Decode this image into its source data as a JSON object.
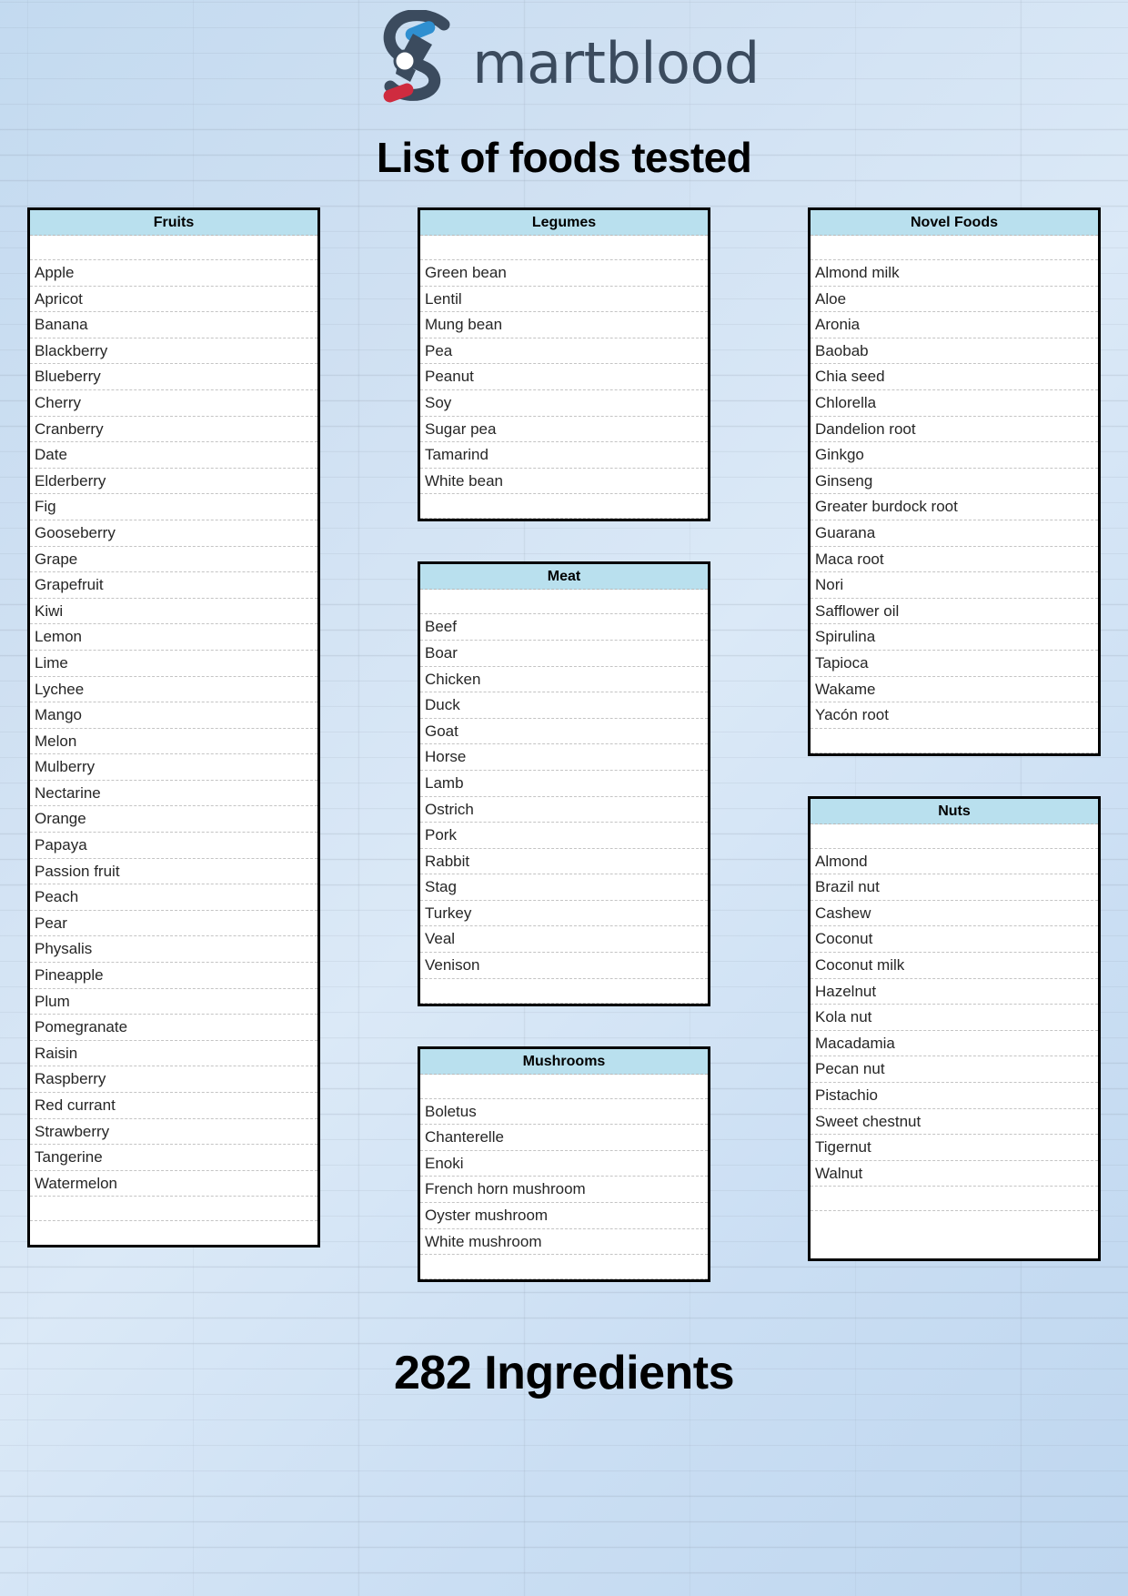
{
  "brand": {
    "name": "Smartblood",
    "text_after_mark": "martblood",
    "logo_icon": "microscope-s-logo",
    "colors": {
      "text": "#3b4b5e",
      "slide_blue": "#2f8fd0",
      "slide_red": "#cf2b3f",
      "header_band": "#b9e0ee",
      "page_background": "#cfe0f2"
    }
  },
  "page_title": "List of foods tested",
  "footer": {
    "count_label": "282 Ingredients"
  },
  "columns": [
    {
      "id": "column-left",
      "tables": [
        {
          "id": "fruits",
          "header": "Fruits",
          "items": [
            "Apple",
            "Apricot",
            "Banana",
            "Blackberry",
            "Blueberry",
            "Cherry",
            "Cranberry",
            "Date",
            "Elderberry",
            "Fig",
            "Gooseberry",
            "Grape",
            "Grapefruit",
            "Kiwi",
            "Lemon",
            "Lime",
            "Lychee",
            "Mango",
            "Melon",
            "Mulberry",
            "Nectarine",
            "Orange",
            "Papaya",
            "Passion fruit",
            "Peach",
            "Pear",
            "Physalis",
            "Pineapple",
            "Plum",
            "Pomegranate",
            "Raisin",
            "Raspberry",
            "Red currant",
            "Strawberry",
            "Tangerine",
            "Watermelon"
          ]
        }
      ]
    },
    {
      "id": "column-middle",
      "tables": [
        {
          "id": "legumes",
          "header": "Legumes",
          "items": [
            "Green bean",
            "Lentil",
            "Mung bean",
            "Pea",
            "Peanut",
            "Soy",
            "Sugar pea",
            "Tamarind",
            "White bean"
          ]
        },
        {
          "id": "meat",
          "header": "Meat",
          "items": [
            "Beef",
            "Boar",
            "Chicken",
            "Duck",
            "Goat",
            "Horse",
            "Lamb",
            "Ostrich",
            "Pork",
            "Rabbit",
            "Stag",
            "Turkey",
            "Veal",
            "Venison"
          ]
        },
        {
          "id": "mushrooms",
          "header": "Mushrooms",
          "items": [
            "Boletus",
            "Chanterelle",
            "Enoki",
            "French horn mushroom",
            "Oyster mushroom",
            "White mushroom"
          ]
        }
      ]
    },
    {
      "id": "column-right",
      "tables": [
        {
          "id": "novel-foods",
          "header": "Novel Foods",
          "items": [
            "Almond milk",
            "Aloe",
            "Aronia",
            "Baobab",
            "Chia seed",
            "Chlorella",
            "Dandelion root",
            "Ginkgo",
            "Ginseng",
            "Greater burdock root",
            "Guarana",
            "Maca root",
            "Nori",
            "Safflower oil",
            "Spirulina",
            "Tapioca",
            "Wakame",
            "Yacón root"
          ]
        },
        {
          "id": "nuts",
          "header": "Nuts",
          "items": [
            "Almond",
            "Brazil nut",
            "Cashew",
            "Coconut",
            "Coconut milk",
            "Hazelnut",
            "Kola nut",
            "Macadamia",
            "Pecan nut",
            "Pistachio",
            "Sweet chestnut",
            "Tigernut",
            "Walnut"
          ]
        }
      ]
    }
  ]
}
